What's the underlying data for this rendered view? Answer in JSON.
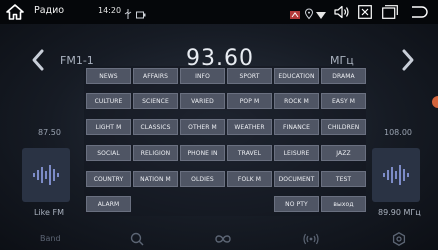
{
  "statusbar": {
    "app_title": "Радио",
    "time": "14:20",
    "icons": [
      "home-icon",
      "usb-icon",
      "battery-icon",
      "network-icon",
      "location-icon",
      "wifi-icon",
      "volume-icon",
      "close-window-icon",
      "window-icon",
      "back-icon"
    ]
  },
  "radio": {
    "band": "FM1-1",
    "frequency": "93.60",
    "unit": "МГц",
    "left_freq": "87.50",
    "right_freq": "108.00",
    "left_preset_name": "Like FM",
    "right_preset_name": "89.90 МГц"
  },
  "tabbar": {
    "band_label": "Band",
    "icons": [
      "search-icon",
      "loop-icon",
      "radio-signal-icon",
      "settings-icon"
    ]
  },
  "pty": {
    "rows": [
      [
        "NEWS",
        "AFFAIRS",
        "INFO",
        "SPORT",
        "EDUCATION",
        "DRAMA"
      ],
      [
        "CULTURE",
        "SCIENCE",
        "VARIED",
        "POP M",
        "ROCK M",
        "EASY M"
      ],
      [
        "LIGHT M",
        "CLASSICS",
        "OTHER M",
        "WEATHER",
        "FINANCE",
        "CHILDREN"
      ],
      [
        "SOCIAL",
        "RELIGION",
        "PHONE IN",
        "TRAVEL",
        "LEISURE",
        "JAZZ"
      ],
      [
        "COUNTRY",
        "NATION M",
        "OLDIES",
        "FOLK M",
        "DOCUMENT",
        "TEST"
      ],
      [
        "ALARM",
        "",
        "",
        "",
        "NO PTY",
        "выход"
      ]
    ]
  }
}
